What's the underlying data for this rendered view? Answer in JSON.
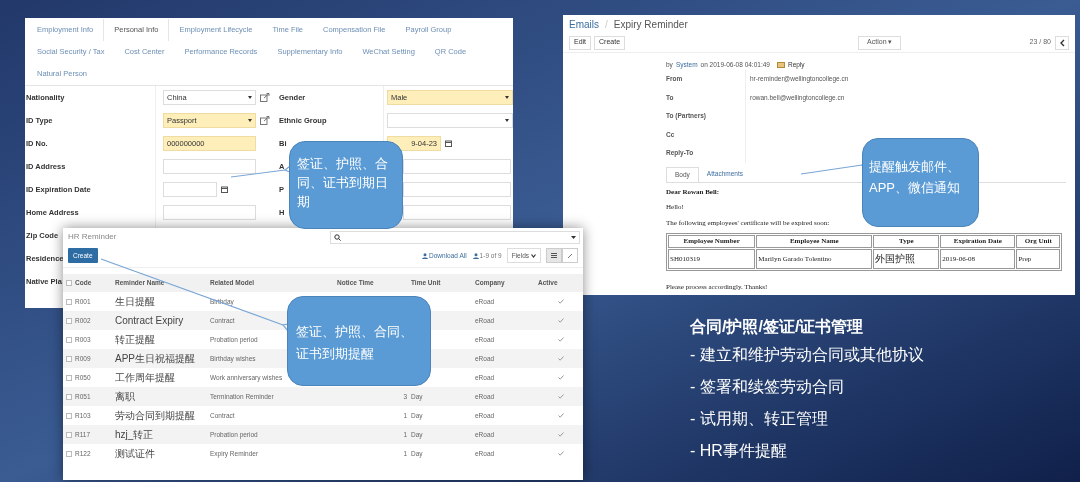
{
  "employee_form": {
    "tabs": [
      {
        "label": "Employment Info",
        "selected": false
      },
      {
        "label": "Personal Info",
        "selected": true
      },
      {
        "label": "Employment Lifecycle",
        "selected": false
      },
      {
        "label": "Time File",
        "selected": false
      },
      {
        "label": "Compensation File",
        "selected": false
      },
      {
        "label": "Payroll Group",
        "selected": false
      },
      {
        "label": "Social Security / Tax",
        "selected": false
      },
      {
        "label": "Cost Center",
        "selected": false
      },
      {
        "label": "Performance Records",
        "selected": false
      },
      {
        "label": "Supplementary Info",
        "selected": false
      },
      {
        "label": "WeChat Setting",
        "selected": false
      },
      {
        "label": "QR Code",
        "selected": false
      },
      {
        "label": "Natural Person",
        "selected": false
      }
    ],
    "left_fields": [
      {
        "label": "Nationality",
        "kind": "select",
        "value": "China",
        "required": false,
        "link": true
      },
      {
        "label": "ID Type",
        "kind": "select",
        "value": "Passport",
        "required": true,
        "link": true
      },
      {
        "label": "ID No.",
        "kind": "input",
        "value": "000000000",
        "required": true
      },
      {
        "label": "ID Address",
        "kind": "input",
        "required": false
      },
      {
        "label": "ID Expiration Date",
        "kind": "date",
        "required": false
      },
      {
        "label": "Home Address",
        "kind": "input",
        "required": false
      },
      {
        "label": "Zip Code",
        "kind": "none"
      },
      {
        "label": "Residence",
        "kind": "none"
      },
      {
        "label": "Native Pla",
        "kind": "none"
      }
    ],
    "right_fields": [
      {
        "label": "Gender",
        "kind": "select",
        "value": "Male",
        "required": true
      },
      {
        "label": "Ethnic Group",
        "kind": "select",
        "required": false
      },
      {
        "label": "Bi",
        "kind": "date",
        "value": "9-04-23",
        "required": true
      },
      {
        "label": "A",
        "kind": "input",
        "required": false
      },
      {
        "label": "P",
        "kind": "input",
        "required": false
      },
      {
        "label": "H",
        "kind": "input",
        "required": false
      }
    ]
  },
  "hr_reminder": {
    "title": "HR Reminder",
    "select_all_checked": false,
    "create": "Create",
    "download": "Download All",
    "count": "1-9 of 9",
    "fields": "Fields",
    "columns": [
      "Code",
      "Reminder Name",
      "Related Model",
      "Notice Time",
      "Time Unit",
      "Company",
      "Active"
    ],
    "rows": [
      {
        "code": "R001",
        "name": "生日提醒",
        "model": "Birthday",
        "company": "eRoad",
        "active": true,
        "checked": false
      },
      {
        "code": "R002",
        "name": "Contract Expiry",
        "model": "Contract",
        "company": "eRoad",
        "active": true,
        "checked": false
      },
      {
        "code": "R003",
        "name": "转正提醒",
        "model": "Probation period",
        "company": "eRoad",
        "active": true,
        "checked": false
      },
      {
        "code": "R009",
        "name": "APP生日祝福提醒",
        "model": "Birthday wishes",
        "company": "eRoad",
        "active": true,
        "checked": false
      },
      {
        "code": "R050",
        "name": "工作周年提醒",
        "model": "Work anniversary wishes",
        "company": "eRoad",
        "active": true,
        "checked": false
      },
      {
        "code": "R051",
        "name": "离职",
        "model": "Termination Reminder",
        "notice": "3",
        "unit": "Day",
        "company": "eRoad",
        "active": true,
        "checked": false
      },
      {
        "code": "R103",
        "name": "劳动合同到期提醒",
        "model": "Contract",
        "notice": "1",
        "unit": "Day",
        "company": "eRoad",
        "active": true,
        "checked": false
      },
      {
        "code": "R117",
        "name": "hzj_转正",
        "model": "Probation period",
        "notice": "1",
        "unit": "Day",
        "company": "eRoad",
        "active": true,
        "checked": false
      },
      {
        "code": "R122",
        "name": "测试证件",
        "model": "Expiry Reminder",
        "notice": "1",
        "unit": "Day",
        "company": "eRoad",
        "active": true,
        "checked": false
      }
    ]
  },
  "email": {
    "breadcrumb": [
      "Emails",
      "Expiry Reminder"
    ],
    "separator": "/",
    "buttons": [
      "Edit",
      "Create"
    ],
    "action": "Action ▾",
    "pager": "23 / 80",
    "meta": {
      "by": "by",
      "author": "System",
      "date": "on 2019-06-08 04:01:49",
      "reply": "Reply"
    },
    "headers": [
      {
        "label": "From",
        "value": "hr-reminder@wellingtoncollege.cn"
      },
      {
        "label": "To",
        "value": "rowan.bell@wellingtoncollege.cn"
      },
      {
        "label": "To (Partners)"
      },
      {
        "label": "Cc"
      },
      {
        "label": "Reply-To"
      }
    ],
    "tabs": [
      {
        "label": "Body",
        "selected": true
      },
      {
        "label": "Attachments",
        "selected": false
      }
    ],
    "greeting": "Dear Rowan Bell:",
    "hello": "Hello!",
    "intro": "The following employees' certificate will be expired soon:",
    "table": {
      "columns": [
        "Employee Number",
        "Employee Name",
        "Type",
        "Expiration Date",
        "Org Unit"
      ],
      "rows": [
        [
          "SH010319",
          "Marilyn Garado Tolentino",
          "外国护照",
          "2019-06-08",
          "Prep"
        ]
      ]
    },
    "closing": "Please process accordingly. Thanks!"
  },
  "callouts": [
    "签证、护照、合同、证书到期日期",
    "签证、护照、合同、证书到期提醒",
    "提醒触发邮件、APP、微信通知"
  ],
  "slide": {
    "heading": "合同/护照/签证/证书管理",
    "bullets": [
      "- 建立和维护劳动合同或其他协议",
      "- 签署和续签劳动合同",
      "- 试用期、转正管理",
      "- HR事件提醒"
    ]
  }
}
